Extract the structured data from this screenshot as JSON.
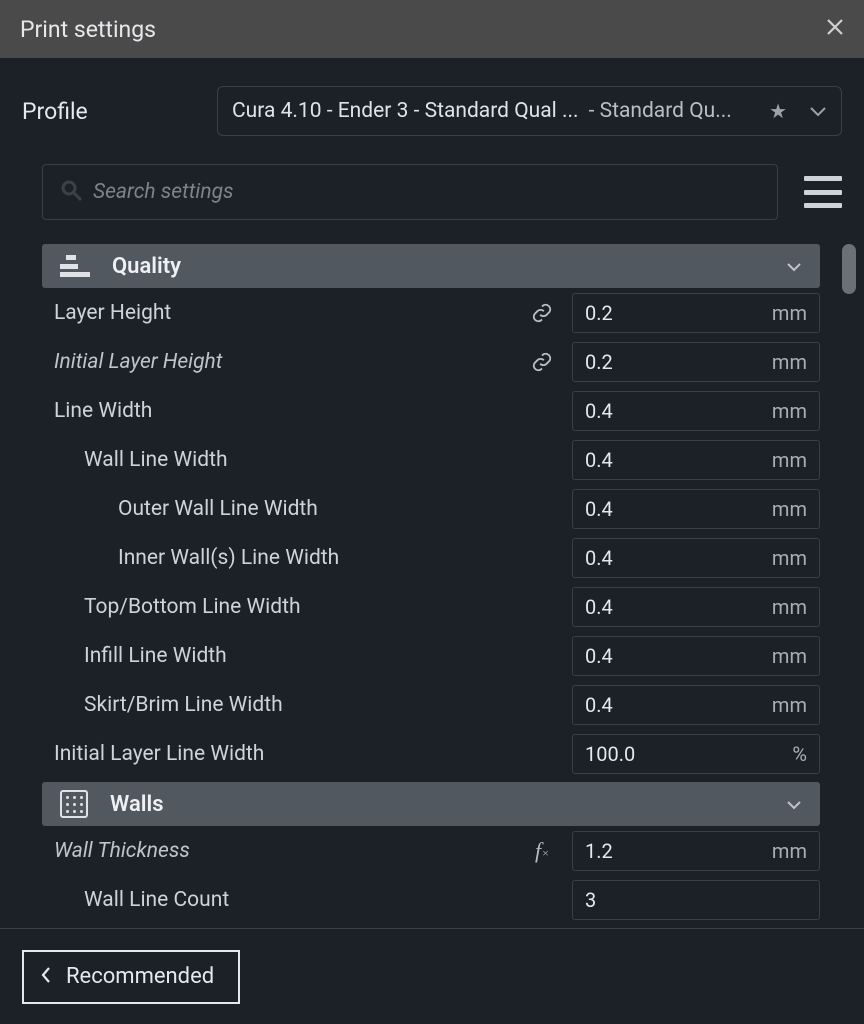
{
  "window": {
    "title": "Print settings"
  },
  "profile": {
    "label": "Profile",
    "text_main": "Cura 4.10 - Ender 3 - Standard Qual ...",
    "text_sub": "- Standard Qu..."
  },
  "search": {
    "placeholder": "Search settings"
  },
  "sections": {
    "quality": {
      "title": "Quality"
    },
    "walls": {
      "title": "Walls"
    }
  },
  "settings": {
    "layer_height": {
      "label": "Layer Height",
      "value": "0.2",
      "unit": "mm"
    },
    "initial_layer_height": {
      "label": "Initial Layer Height",
      "value": "0.2",
      "unit": "mm"
    },
    "line_width": {
      "label": "Line Width",
      "value": "0.4",
      "unit": "mm"
    },
    "wall_line_width": {
      "label": "Wall Line Width",
      "value": "0.4",
      "unit": "mm"
    },
    "outer_wall_lw": {
      "label": "Outer Wall Line Width",
      "value": "0.4",
      "unit": "mm"
    },
    "inner_wall_lw": {
      "label": "Inner Wall(s) Line Width",
      "value": "0.4",
      "unit": "mm"
    },
    "top_bottom_lw": {
      "label": "Top/Bottom Line Width",
      "value": "0.4",
      "unit": "mm"
    },
    "infill_lw": {
      "label": "Infill Line Width",
      "value": "0.4",
      "unit": "mm"
    },
    "skirt_brim_lw": {
      "label": "Skirt/Brim Line Width",
      "value": "0.4",
      "unit": "mm"
    },
    "initial_layer_lw": {
      "label": "Initial Layer Line Width",
      "value": "100.0",
      "unit": "%"
    },
    "wall_thickness": {
      "label": "Wall Thickness",
      "value": "1.2",
      "unit": "mm"
    },
    "wall_line_count": {
      "label": "Wall Line Count",
      "value": "3",
      "unit": ""
    }
  },
  "footer": {
    "recommended": "Recommended"
  }
}
